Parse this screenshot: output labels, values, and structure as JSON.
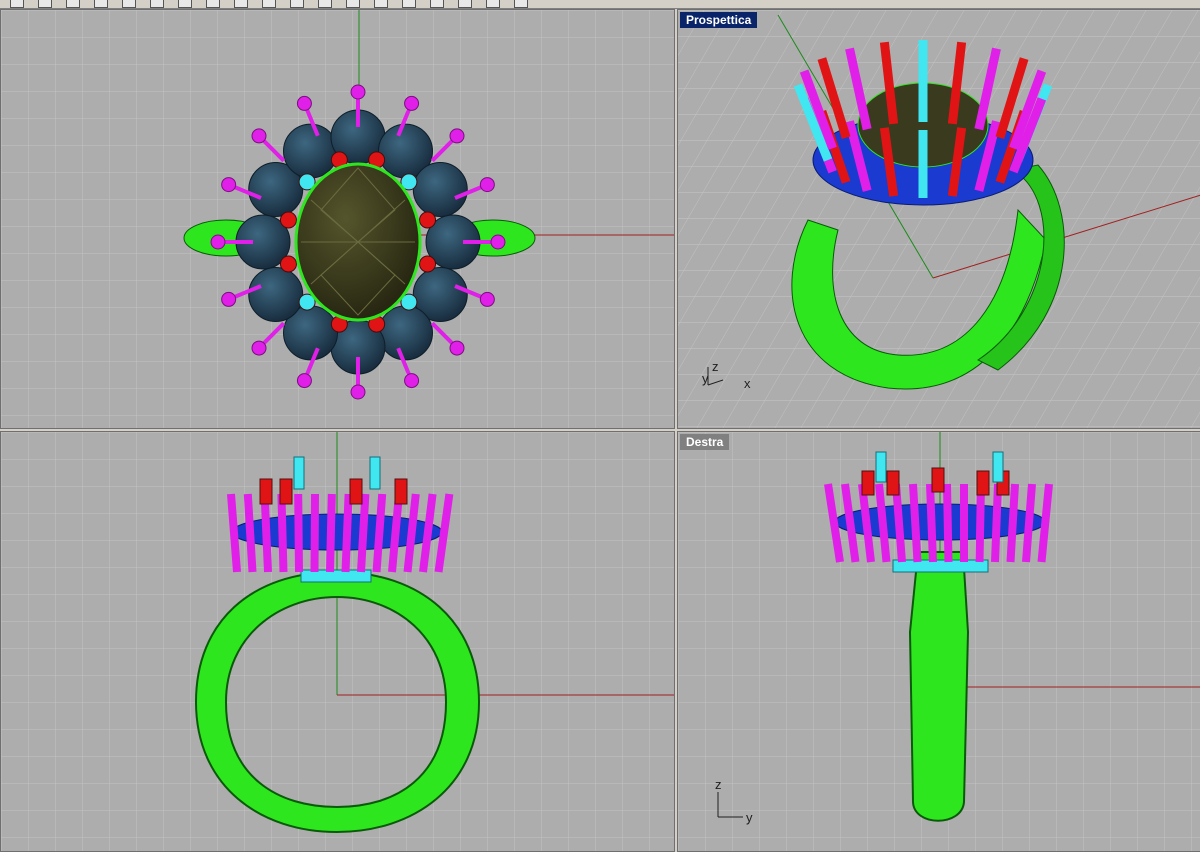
{
  "toolbar": {
    "icons": [
      "new-icon",
      "open-icon",
      "save-icon",
      "print-icon",
      "cut-icon",
      "copy-icon",
      "paste-icon",
      "undo-icon",
      "redo-icon",
      "pan-icon",
      "rotate-icon",
      "zoom-icon",
      "zoom-window-icon",
      "zoom-extents-icon",
      "select-icon",
      "layer-icon",
      "properties-icon",
      "render-icon",
      "help-icon"
    ]
  },
  "viewports": {
    "top": {
      "title": ""
    },
    "perspective": {
      "title": "Prospettica",
      "axes": {
        "x": "x",
        "y": "y",
        "z": "z"
      }
    },
    "front": {
      "title": ""
    },
    "right": {
      "title": "Destra",
      "axes": {
        "y": "y",
        "z": "z"
      }
    }
  },
  "colors": {
    "background": "#adadad",
    "grid": "#c4c4c4",
    "shank": "#2ee61e",
    "prong": "#e020e8",
    "red_prong": "#e01414",
    "cyan_prong": "#40e6f0",
    "stone_center": "#3a3a1e",
    "stone_side": "#1e3a4e",
    "gallery": "#1a3ad0"
  }
}
